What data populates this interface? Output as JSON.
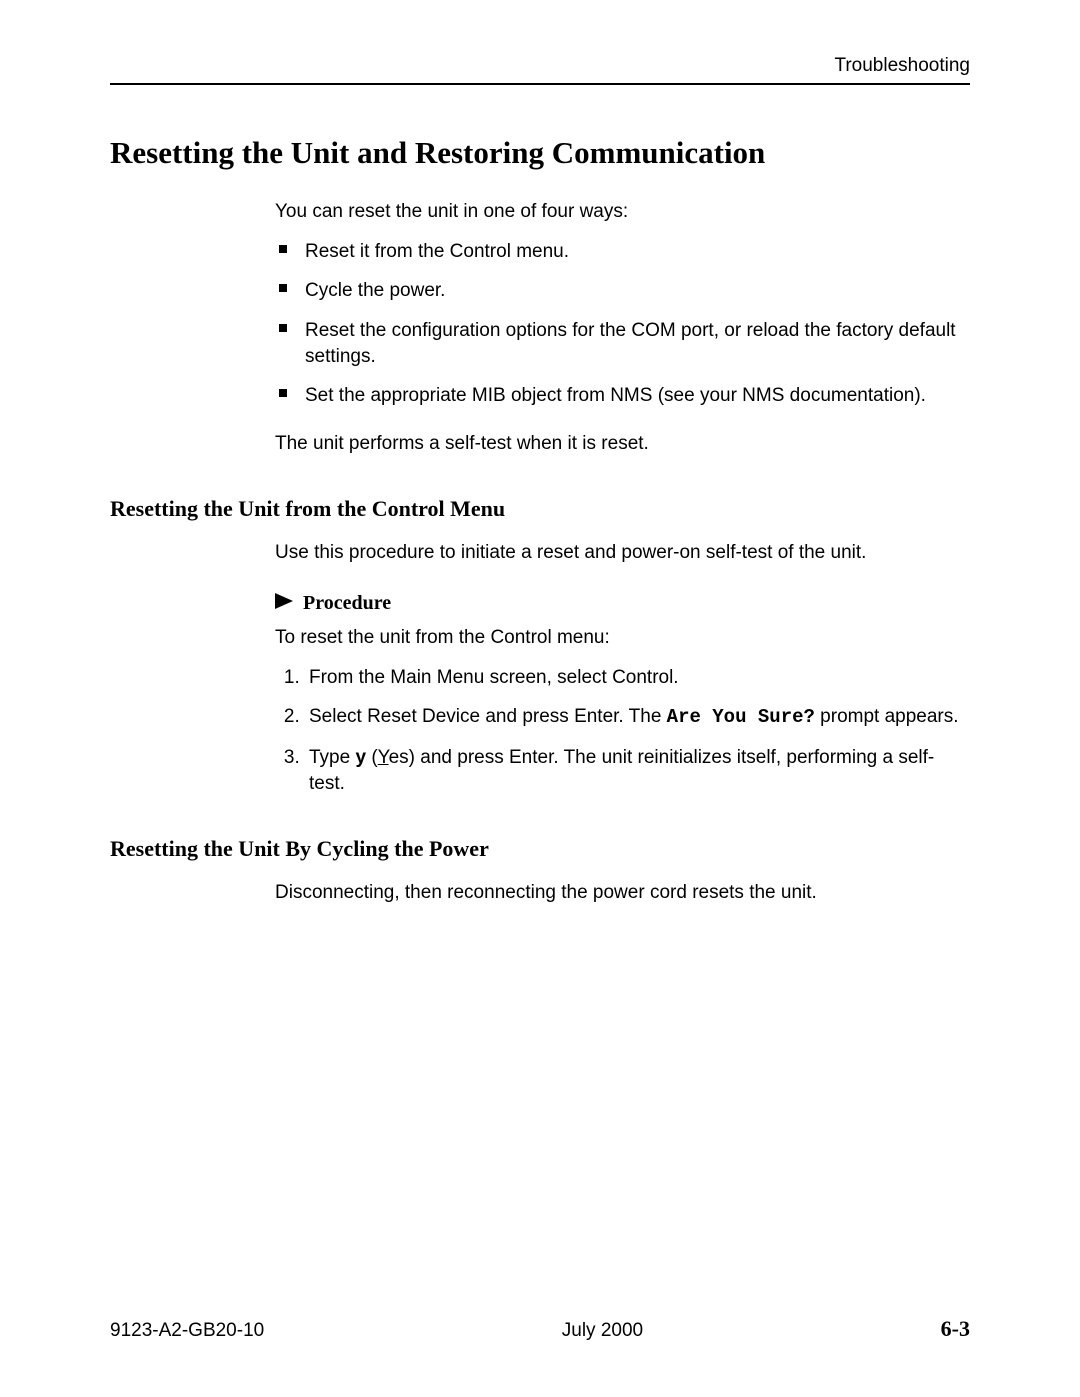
{
  "header": {
    "section": "Troubleshooting"
  },
  "title": "Resetting the Unit and Restoring Communication",
  "intro": "You can reset the unit in one of four ways:",
  "bullets": [
    "Reset it from the Control menu.",
    "Cycle the power.",
    "Reset the configuration options for the COM port, or reload the factory default settings.",
    "Set the appropriate MIB object from NMS (see your NMS documentation)."
  ],
  "after_bullets": "The unit performs a self-test when it is reset.",
  "section1": {
    "heading": "Resetting the Unit from the Control Menu",
    "intro": "Use this procedure to initiate a reset and power-on self-test of the unit.",
    "procedure_label": "Procedure",
    "procedure_intro": "To reset the unit from the Control menu:",
    "steps": {
      "s1": "From the Main Menu screen, select Control.",
      "s2_a": "Select Reset Device and press Enter. The ",
      "s2_code": "Are You Sure?",
      "s2_b": " prompt appears.",
      "s3_a": "Type ",
      "s3_bold": "y",
      "s3_b": " (",
      "s3_ul": "Y",
      "s3_c": "es) and press Enter. The unit reinitializes itself, performing a self-test."
    }
  },
  "section2": {
    "heading": "Resetting the Unit By Cycling the Power",
    "body": "Disconnecting, then reconnecting the power cord resets the unit."
  },
  "footer": {
    "doc": "9123-A2-GB20-10",
    "date": "July 2000",
    "page": "6-3"
  }
}
